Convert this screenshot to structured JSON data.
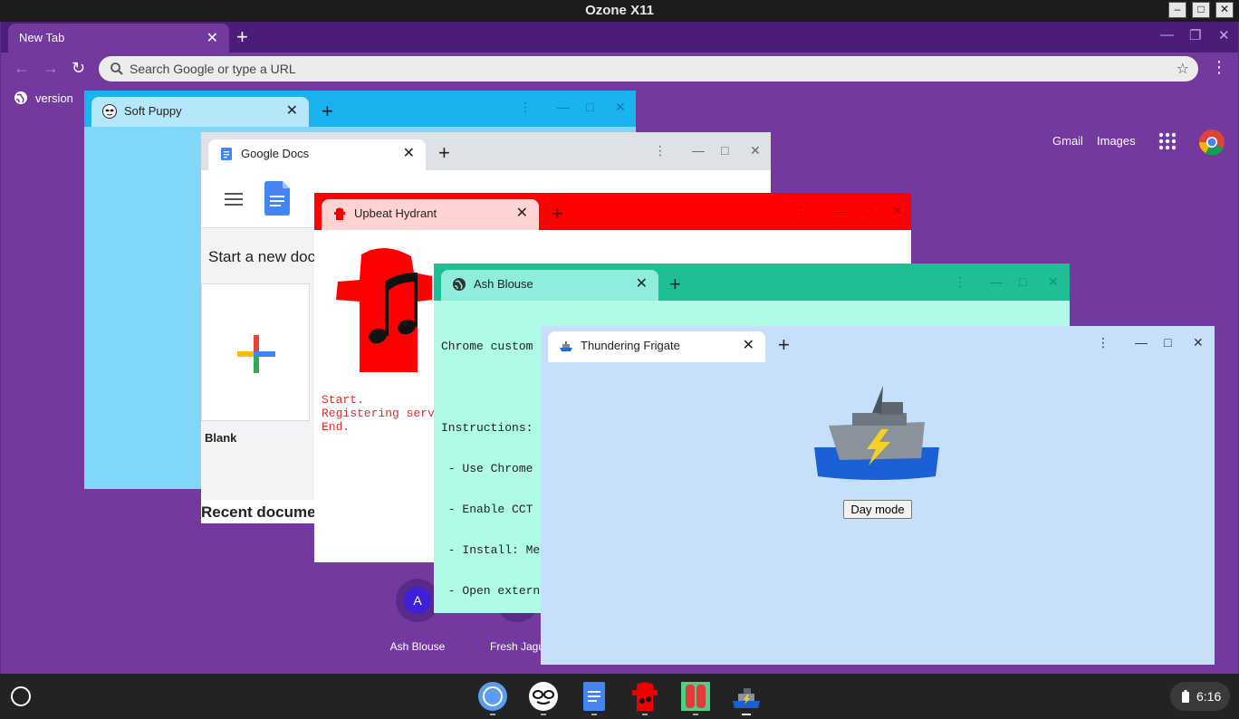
{
  "x11": {
    "title": "Ozone X11"
  },
  "main": {
    "tab_title": "New Tab",
    "search_placeholder": "Search Google or type a URL",
    "bookmark": "version",
    "links": {
      "gmail": "Gmail",
      "images": "Images"
    },
    "shortcuts": [
      {
        "letter": "A",
        "name": "Ash Blouse"
      },
      {
        "letter": "",
        "name": "Fresh Jagu"
      }
    ]
  },
  "windows": {
    "soft_puppy": {
      "tab": "Soft Puppy",
      "color": "#7fd8f9"
    },
    "google_docs": {
      "tab": "Google Docs",
      "heading": "Start a new docu",
      "blank_label": "Blank",
      "recent": "Recent documen"
    },
    "upbeat_hydrant": {
      "tab": "Upbeat Hydrant",
      "log": [
        "Start.",
        "Registering serv",
        "End."
      ]
    },
    "ash_blouse": {
      "tab": "Ash Blouse",
      "lines": [
        "Chrome custom tab test site.",
        "",
        "Instructions:",
        " - Use Chrome",
        " - Enable CCT",
        " - Install: Me",
        " - Open extern"
      ]
    },
    "thundering_frigate": {
      "tab": "Thundering Frigate",
      "button": "Day mode"
    }
  },
  "shelf": {
    "time": "6:16"
  }
}
